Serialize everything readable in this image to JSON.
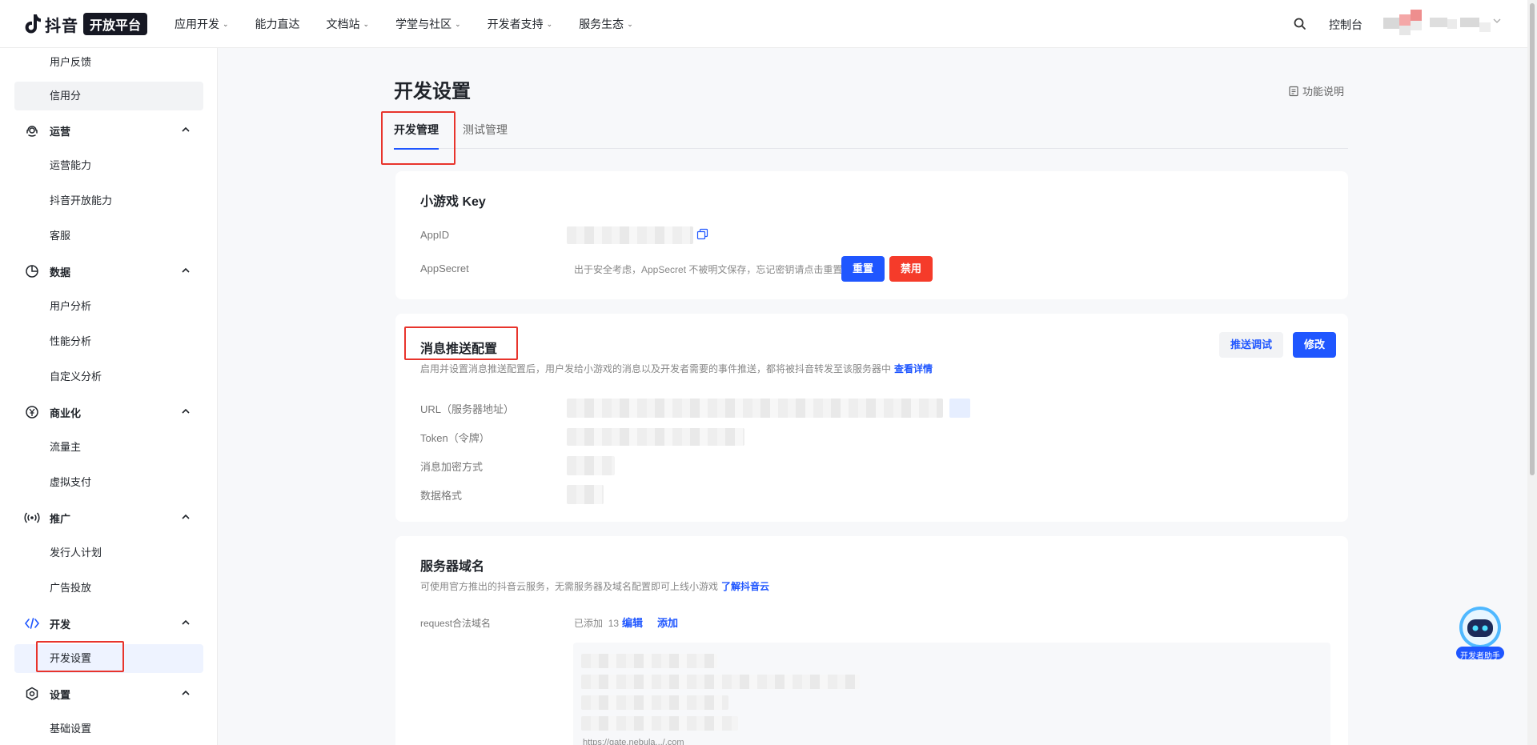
{
  "topnav": {
    "logo_text": "抖音",
    "logo_badge": "开放平台",
    "items": [
      {
        "label": "应用开发",
        "has_dropdown": true
      },
      {
        "label": "能力直达",
        "has_dropdown": false
      },
      {
        "label": "文档站",
        "has_dropdown": true
      },
      {
        "label": "学堂与社区",
        "has_dropdown": true
      },
      {
        "label": "开发者支持",
        "has_dropdown": true
      },
      {
        "label": "服务生态",
        "has_dropdown": true
      }
    ],
    "chevron": "⌄",
    "search_icon": "search-icon",
    "console_label": "控制台"
  },
  "sidebar": {
    "items": [
      {
        "kind": "sub",
        "label": "用户反馈"
      },
      {
        "kind": "sub",
        "label": "信用分",
        "state": "gray"
      },
      {
        "kind": "group",
        "label": "运营",
        "icon": "operations-icon"
      },
      {
        "kind": "sub",
        "label": "运营能力"
      },
      {
        "kind": "sub",
        "label": "抖音开放能力"
      },
      {
        "kind": "sub",
        "label": "客服"
      },
      {
        "kind": "group",
        "label": "数据",
        "icon": "pie-chart-icon"
      },
      {
        "kind": "sub",
        "label": "用户分析"
      },
      {
        "kind": "sub",
        "label": "性能分析"
      },
      {
        "kind": "sub",
        "label": "自定义分析"
      },
      {
        "kind": "group",
        "label": "商业化",
        "icon": "yuan-icon"
      },
      {
        "kind": "sub",
        "label": "流量主"
      },
      {
        "kind": "sub",
        "label": "虚拟支付"
      },
      {
        "kind": "group",
        "label": "推广",
        "icon": "broadcast-icon"
      },
      {
        "kind": "sub",
        "label": "发行人计划"
      },
      {
        "kind": "sub",
        "label": "广告投放"
      },
      {
        "kind": "group",
        "label": "开发",
        "icon": "code-icon"
      },
      {
        "kind": "sub",
        "label": "开发设置",
        "state": "active"
      },
      {
        "kind": "group",
        "label": "设置",
        "icon": "settings-icon"
      },
      {
        "kind": "sub",
        "label": "基础设置"
      }
    ]
  },
  "page": {
    "title": "开发设置",
    "func_desc": "功能说明",
    "tabs": [
      {
        "label": "开发管理",
        "active": true
      },
      {
        "label": "测试管理",
        "active": false
      }
    ]
  },
  "key_card": {
    "title": "小游戏 Key",
    "appid_label": "AppID",
    "appsecret_label": "AppSecret",
    "appsecret_note": "出于安全考虑，AppSecret 不被明文保存，忘记密钥请点击重置",
    "reset_button": "重置",
    "disable_button": "禁用"
  },
  "push_card": {
    "title": "消息推送配置",
    "description": "启用并设置消息推送配置后，用户发给小游戏的消息以及开发者需要的事件推送，都将被抖音转发至该服务器中",
    "detail_link": "查看详情",
    "debug_button": "推送调试",
    "edit_button": "修改",
    "fields": [
      {
        "label": "URL（服务器地址）"
      },
      {
        "label": "Token（令牌）"
      },
      {
        "label": "消息加密方式"
      },
      {
        "label": "数据格式"
      }
    ]
  },
  "domain_card": {
    "title": "服务器域名",
    "description": "可使用官方推出的抖音云服务，无需服务器及域名配置即可上线小游戏",
    "cloud_link": "了解抖音云",
    "request_label": "request合法域名",
    "added_text": "已添加",
    "added_count": "13",
    "edit_link": "编辑",
    "add_link": "添加",
    "last_domain": "https://gate.nebula.../.com"
  },
  "assistant": {
    "label": "开发者助手"
  },
  "colors": {
    "primary": "#1f56ff",
    "danger": "#f53b2a",
    "highlight_box": "#e8342c"
  }
}
